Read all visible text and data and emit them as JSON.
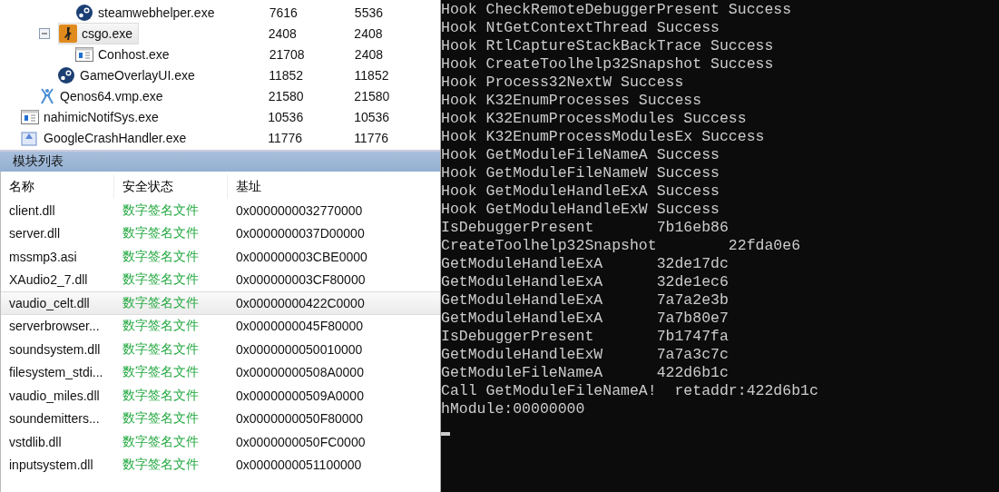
{
  "process_tree": [
    {
      "children": [
        {
          "children": [
            {
              "children": [
                {
                  "name": "steamwebhelper.exe",
                  "kind": "steam",
                  "selected": false,
                  "values": [
                    "7616",
                    "5536"
                  ]
                }
              ]
            },
            {
              "name": "csgo.exe",
              "kind": "game",
              "selected": true,
              "expanded": true,
              "values": [
                "2408",
                "2408"
              ],
              "children": [
                {
                  "name": "Conhost.exe",
                  "kind": "window",
                  "selected": false,
                  "values": [
                    "21708",
                    "2408"
                  ]
                }
              ]
            },
            {
              "name": "GameOverlayUI.exe",
              "kind": "steam",
              "selected": false,
              "values": [
                "11852",
                "11852"
              ]
            }
          ]
        },
        {
          "name": "Qenos64.vmp.exe",
          "kind": "figure",
          "selected": false,
          "values": [
            "21580",
            "21580"
          ]
        }
      ]
    },
    {
      "name": "nahimicNotifSys.exe",
      "kind": "window",
      "selected": false,
      "values": [
        "10536",
        "10536"
      ]
    },
    {
      "name": "GoogleCrashHandler.exe",
      "kind": "crash",
      "selected": false,
      "values": [
        "11776",
        "11776"
      ]
    }
  ],
  "module_list": {
    "title": "模块列表",
    "columns": [
      "名称",
      "安全状态",
      "基址"
    ],
    "rows": [
      {
        "name": "client.dll",
        "status": "数字签名文件",
        "base": "0x0000000032770000",
        "selected": false
      },
      {
        "name": "server.dll",
        "status": "数字签名文件",
        "base": "0x0000000037D00000",
        "selected": false
      },
      {
        "name": "mssmp3.asi",
        "status": "数字签名文件",
        "base": "0x000000003CBE0000",
        "selected": false
      },
      {
        "name": "XAudio2_7.dll",
        "status": "数字签名文件",
        "base": "0x000000003CF80000",
        "selected": false
      },
      {
        "name": "vaudio_celt.dll",
        "status": "数字签名文件",
        "base": "0x00000000422C0000",
        "selected": true
      },
      {
        "name": "serverbrowser...",
        "status": "数字签名文件",
        "base": "0x0000000045F80000",
        "selected": false
      },
      {
        "name": "soundsystem.dll",
        "status": "数字签名文件",
        "base": "0x0000000050010000",
        "selected": false
      },
      {
        "name": "filesystem_stdi...",
        "status": "数字签名文件",
        "base": "0x00000000508A0000",
        "selected": false
      },
      {
        "name": "vaudio_miles.dll",
        "status": "数字签名文件",
        "base": "0x00000000509A0000",
        "selected": false
      },
      {
        "name": "soundemitters...",
        "status": "数字签名文件",
        "base": "0x0000000050F80000",
        "selected": false
      },
      {
        "name": "vstdlib.dll",
        "status": "数字签名文件",
        "base": "0x0000000050FC0000",
        "selected": false
      },
      {
        "name": "inputsystem.dll",
        "status": "数字签名文件",
        "base": "0x0000000051100000",
        "selected": false
      }
    ]
  },
  "console": {
    "lines": [
      "Hook CheckRemoteDebuggerPresent Success",
      "Hook NtGetContextThread Success",
      "Hook RtlCaptureStackBackTrace Success",
      "Hook CreateToolhelp32Snapshot Success",
      "Hook Process32NextW Success",
      "Hook K32EnumProcesses Success",
      "Hook K32EnumProcessModules Success",
      "Hook K32EnumProcessModulesEx Success",
      "Hook GetModuleFileNameA Success",
      "Hook GetModuleFileNameW Success",
      "Hook GetModuleHandleExA Success",
      "Hook GetModuleHandleExW Success",
      "IsDebuggerPresent       7b16eb86",
      "CreateToolhelp32Snapshot        22fda0e6",
      "GetModuleHandleExA      32de17dc",
      "GetModuleHandleExA      32de1ec6",
      "GetModuleHandleExA      7a7a2e3b",
      "GetModuleHandleExA      7a7b80e7",
      "IsDebuggerPresent       7b1747fa",
      "GetModuleHandleExW      7a7a3c7c",
      "GetModuleFileNameA      422d6b1c",
      "Call GetModuleFileNameA!  retaddr:422d6b1c",
      "hModule:00000000"
    ]
  }
}
